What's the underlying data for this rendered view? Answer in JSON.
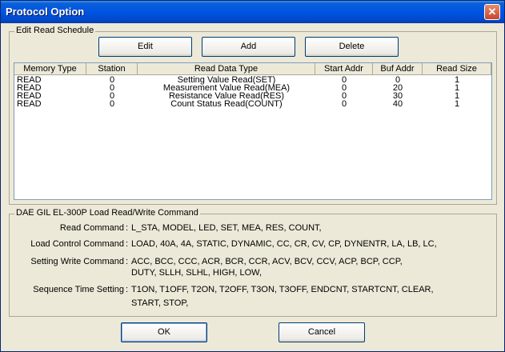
{
  "window": {
    "title": "Protocol Option",
    "close_glyph": "✕"
  },
  "schedule": {
    "group_label": "Edit Read Schedule",
    "buttons": {
      "edit": "Edit",
      "add": "Add",
      "delete": "Delete"
    },
    "columns": [
      "Memory Type",
      "Station",
      "Read Data Type",
      "Start Addr",
      "Buf Addr",
      "Read Size"
    ],
    "rows": [
      [
        "READ",
        "0",
        "Setting Value Read(SET)",
        "0",
        "0",
        "1"
      ],
      [
        "READ",
        "0",
        "Measurement Value Read(MEA)",
        "0",
        "20",
        "1"
      ],
      [
        "READ",
        "0",
        "Resistance Value Read(RES)",
        "0",
        "30",
        "1"
      ],
      [
        "READ",
        "0",
        "Count Status Read(COUNT)",
        "0",
        "40",
        "1"
      ]
    ]
  },
  "commands": {
    "group_label": "DAE GIL EL-300P Load Read/Write Command",
    "items": [
      {
        "label": "Read Command",
        "lines": [
          "L_STA, MODEL, LED, SET,  MEA, RES, COUNT,"
        ]
      },
      {
        "label": "Load Control Command",
        "lines": [
          "LOAD, 40A, 4A, STATIC,  DYNAMIC, CC, CR, CV, CP, DYNENTR, LA, LB, LC,"
        ]
      },
      {
        "label": "Setting Write Command",
        "lines": [
          "ACC, BCC, CCC, ACR, BCR, CCR, ACV, BCV, CCV, ACP, BCP, CCP,",
          "DUTY, SLLH, SLHL, HIGH, LOW,"
        ]
      },
      {
        "label": "Sequence Time Setting",
        "lines": [
          "T1ON, T1OFF, T2ON, T2OFF, T3ON, T3OFF, ENDCNT, STARTCNT, CLEAR,",
          "START, STOP,"
        ]
      }
    ]
  },
  "footer": {
    "ok": "OK",
    "cancel": "Cancel"
  }
}
